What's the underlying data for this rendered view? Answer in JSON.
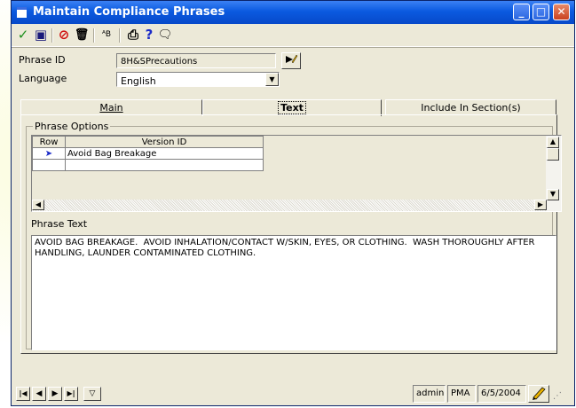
{
  "window": {
    "title": "Maintain Compliance Phrases"
  },
  "toolbar": {
    "save_check": "✓",
    "disk": "▣",
    "cancel": "⊘",
    "delete": "🗑",
    "spell": "ᴬB",
    "print": "⎙",
    "help": "?",
    "comment": "🗨"
  },
  "form": {
    "phrase_id_label": "Phrase ID",
    "phrase_id_value": "8H&SPrecautions",
    "language_label": "Language",
    "language_value": "English"
  },
  "tabs": [
    {
      "label": "Main"
    },
    {
      "label": "Text"
    },
    {
      "label": "Include In Section(s)"
    }
  ],
  "phrase_options": {
    "legend": "Phrase Options",
    "columns": [
      "Row",
      "Version ID"
    ],
    "rows": [
      {
        "row": "➤",
        "version_id": "Avoid Bag Breakage"
      },
      {
        "row": "",
        "version_id": ""
      }
    ]
  },
  "phrase_text": {
    "label": "Phrase Text",
    "value": "AVOID BAG BREAKAGE.  AVOID INHALATION/CONTACT W/SKIN, EYES, OR CLOTHING.  WASH THOROUGHLY AFTER HANDLING, LAUNDER CONTAMINATED CLOTHING."
  },
  "status": {
    "user": "admin",
    "site": "PMA",
    "date": "6/5/2004"
  },
  "colors": {
    "titlebar": "#0b5ae0",
    "window": "#ece9d8",
    "arrow": "#1a2ac8"
  }
}
